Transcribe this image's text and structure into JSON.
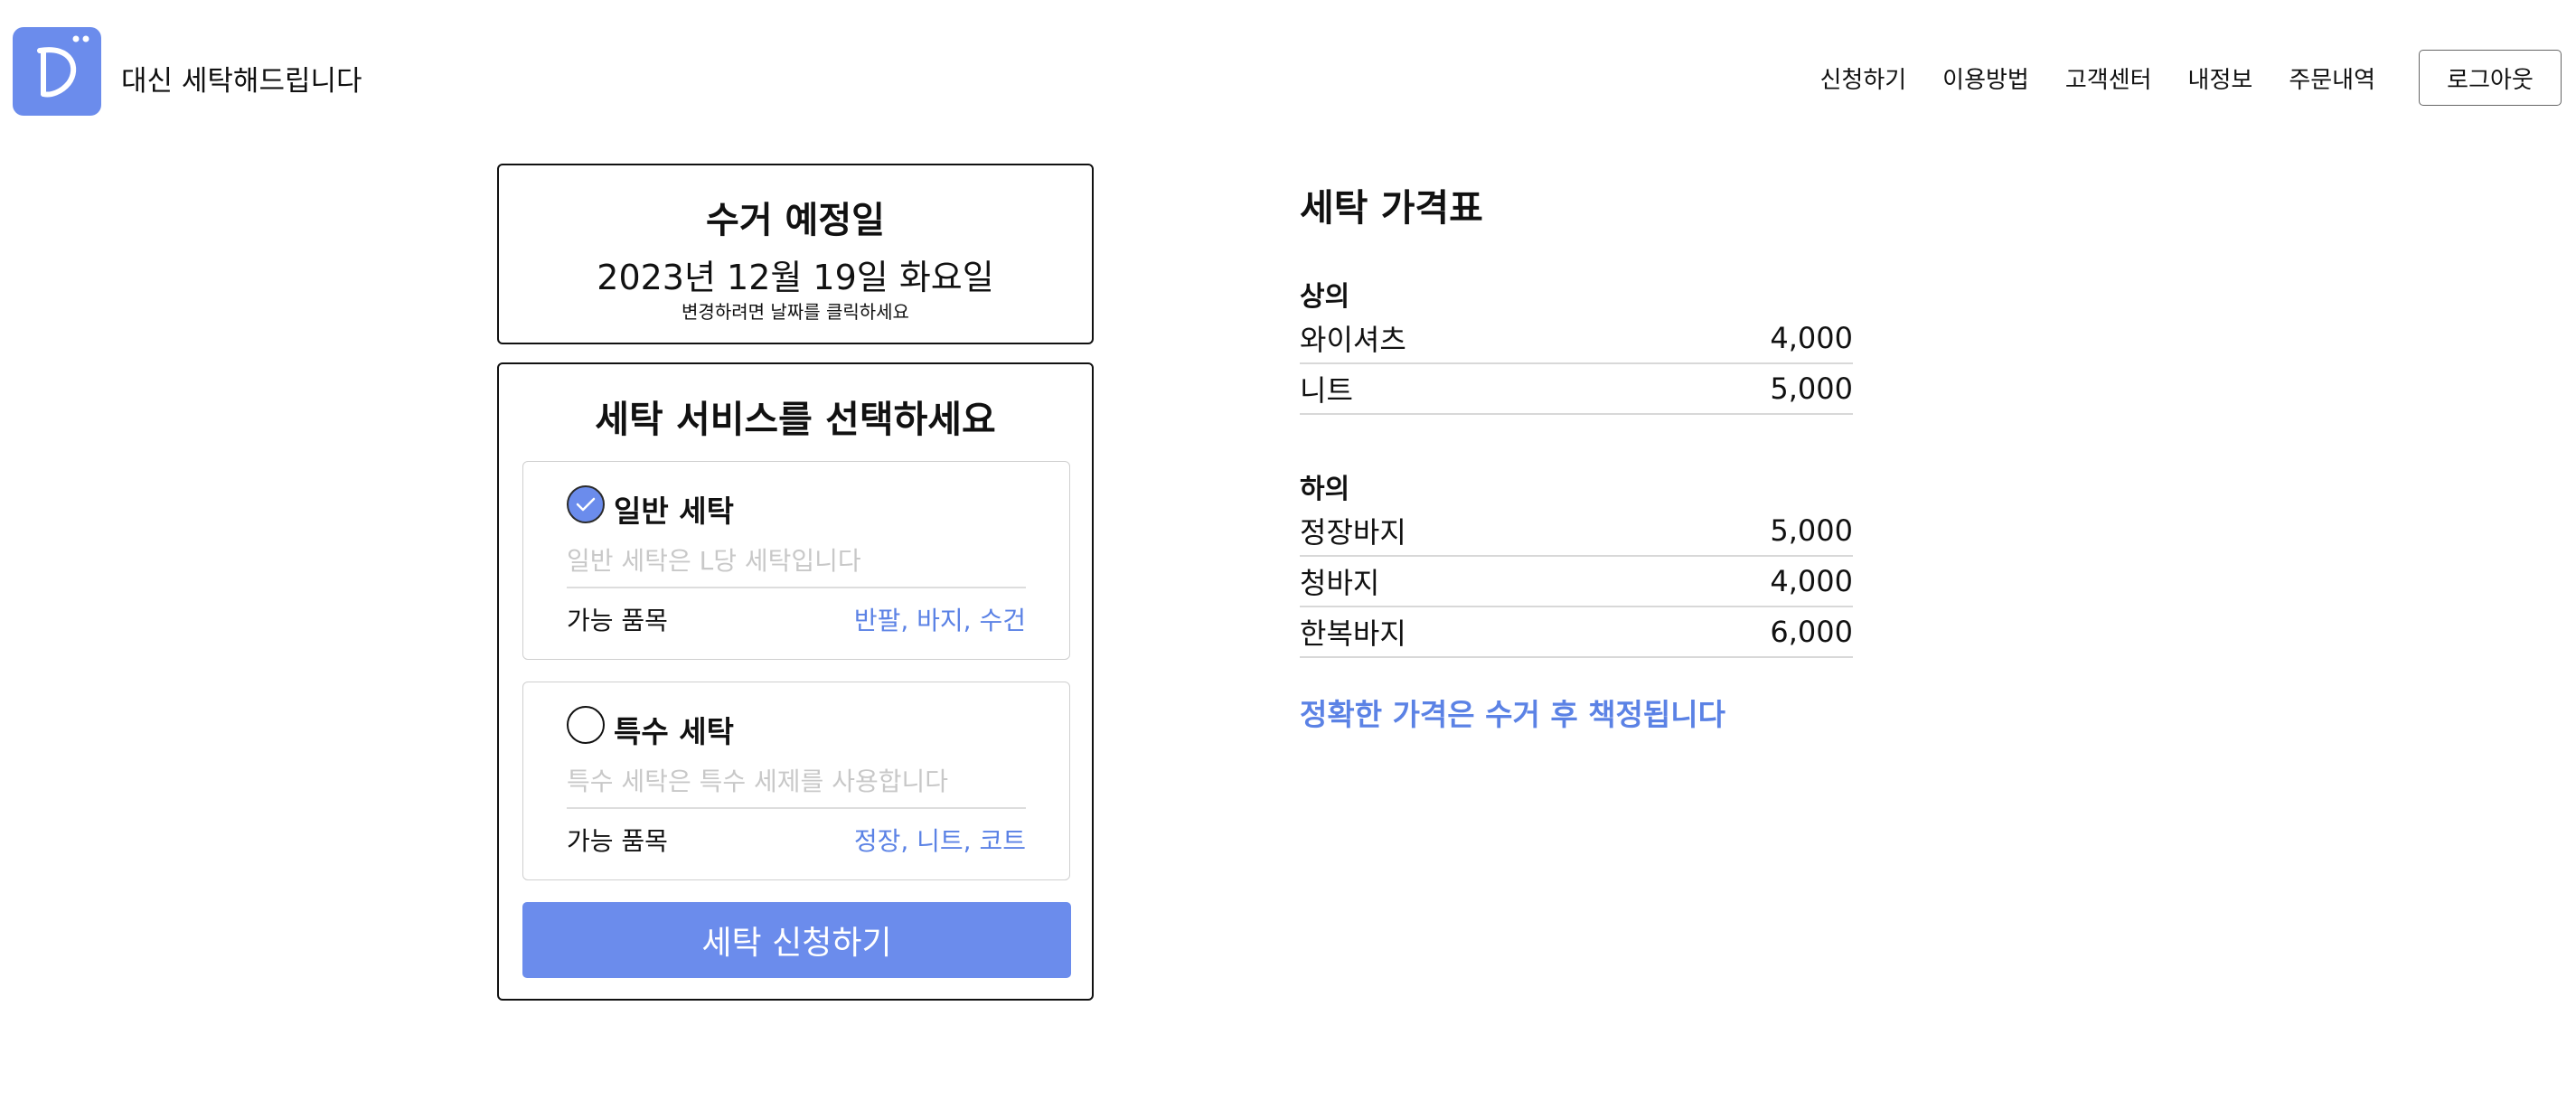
{
  "header": {
    "brand": "대신 세탁해드립니다",
    "nav": [
      "신청하기",
      "이용방법",
      "고객센터",
      "내정보",
      "주문내역"
    ],
    "logout": "로그아웃"
  },
  "pickup": {
    "title": "수거 예정일",
    "date": "2023년 12월 19일 화요일",
    "hint": "변경하려면 날짜를 클릭하세요"
  },
  "service": {
    "title": "세탁 서비스를 선택하세요",
    "options": [
      {
        "title": "일반 세탁",
        "description": "일반 세탁은 L당 세탁입니다",
        "available_label": "가능 품목",
        "available_items": "반팔, 바지, 수건",
        "selected": true
      },
      {
        "title": "특수 세탁",
        "description": "특수 세탁은 특수 세제를 사용합니다",
        "available_label": "가능 품목",
        "available_items": "정장, 니트, 코트",
        "selected": false
      }
    ],
    "submit": "세탁 신청하기"
  },
  "price_list": {
    "title": "세탁 가격표",
    "categories": [
      {
        "name": "상의",
        "items": [
          {
            "name": "와이셔츠",
            "price": "4,000"
          },
          {
            "name": "니트",
            "price": "5,000"
          }
        ]
      },
      {
        "name": "하의",
        "items": [
          {
            "name": "정장바지",
            "price": "5,000"
          },
          {
            "name": "청바지",
            "price": "4,000"
          },
          {
            "name": "한복바지",
            "price": "6,000"
          }
        ]
      }
    ],
    "note": "정확한 가격은 수거 후 책정됩니다"
  },
  "colors": {
    "accent": "#6b8cec",
    "link": "#5b82e5",
    "placeholder": "#c8c8c8",
    "divider": "#d8d8d8"
  }
}
